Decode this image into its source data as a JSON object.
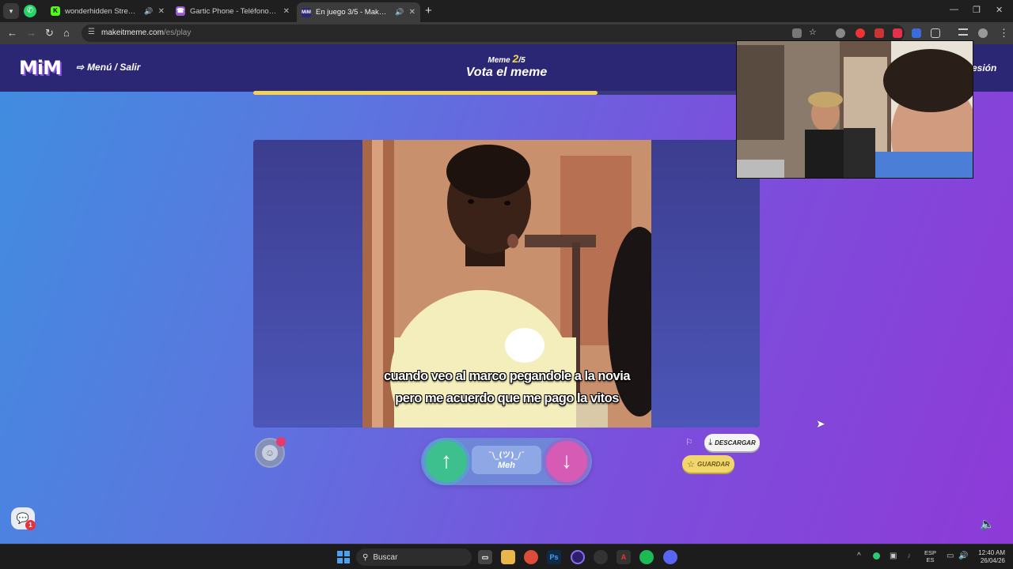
{
  "browser": {
    "tabs": [
      {
        "title": "wonderhidden Stream - W",
        "favicon": "kick-icon",
        "active": false
      },
      {
        "title": "Gartic Phone - Teléfono Descon",
        "favicon": "gartic-icon",
        "active": false
      },
      {
        "title": "En juego 3/5 - Make it Mem",
        "favicon": "mim-icon",
        "active": true
      }
    ],
    "url_host": "makeitmeme.com",
    "url_path": "/es/play"
  },
  "app": {
    "logo": "MiM",
    "menu_exit": "Menú / Salir",
    "round_label": "Meme",
    "round_current": "2",
    "round_total": "/5",
    "phase_title": "Vota el meme",
    "login_partial": "esión",
    "progress": 0.68,
    "accent_color": "#f2d35a"
  },
  "meme": {
    "caption_line1": "cuando veo al marco pegandole a la novia",
    "caption_line2": "pero me acuerdo que me pago la vitos"
  },
  "vote": {
    "up_icon": "arrow-up-icon",
    "down_icon": "arrow-down-icon",
    "meh_face": "¯\\_(ツ)_/¯",
    "meh_label": "Meh"
  },
  "actions": {
    "download_label": "DESCARGAR",
    "save_label": "GUARDAR"
  },
  "chat": {
    "badge_count": "1"
  },
  "taskbar": {
    "search_placeholder": "Buscar",
    "lang_top": "ESP",
    "lang_bottom": "ES",
    "time": "12:40 AM",
    "date": "26/04/26"
  }
}
